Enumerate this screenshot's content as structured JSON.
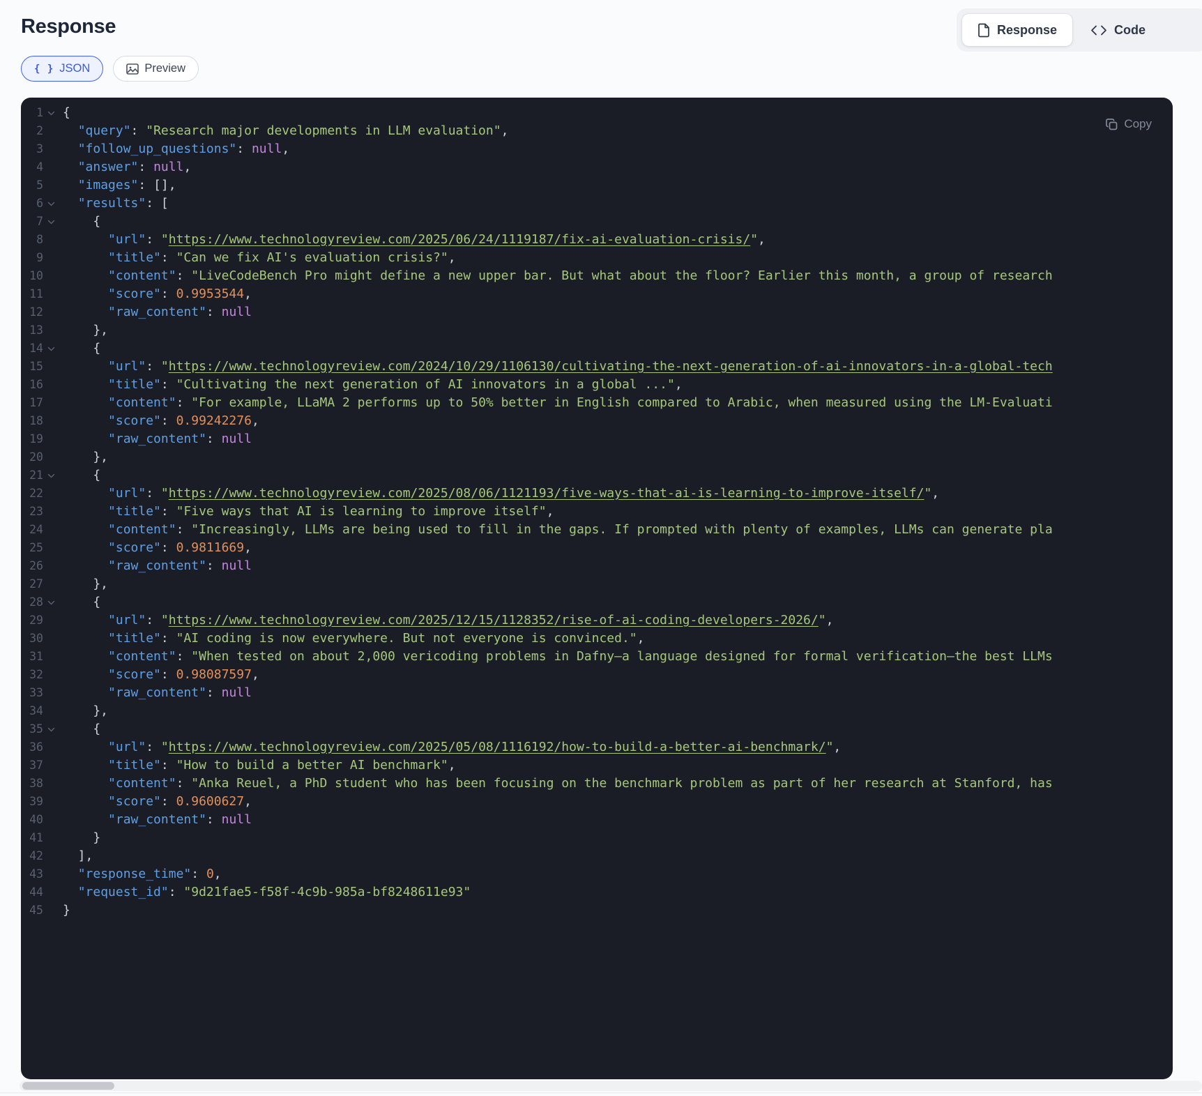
{
  "header": {
    "title": "Response",
    "modes": [
      {
        "label": "Response",
        "icon": "document-icon",
        "active": true
      },
      {
        "label": "Code",
        "icon": "code-icon",
        "active": false
      }
    ]
  },
  "tabs": [
    {
      "label": "JSON",
      "icon": "braces-icon",
      "active": true,
      "icon_glyph": "{ }"
    },
    {
      "label": "Preview",
      "icon": "image-icon",
      "active": false
    }
  ],
  "editor": {
    "copy_label": "Copy",
    "colors": {
      "background": "#1b1d26",
      "line_number": "#58606f",
      "key": "#5e9fe6",
      "string": "#a6c87c",
      "number": "#e2905c",
      "null": "#c287dd",
      "punctuation": "#ccd2dc",
      "accent_blue": "#4263eb"
    },
    "lines": [
      {
        "n": 1,
        "c": true,
        "s": [
          [
            "p",
            "{"
          ]
        ]
      },
      {
        "n": 2,
        "c": false,
        "s": [
          [
            "p",
            "  "
          ],
          [
            "k",
            "\"query\""
          ],
          [
            "p",
            ": "
          ],
          [
            "s",
            "\"Research major developments in LLM evaluation\""
          ],
          [
            "p",
            ","
          ]
        ]
      },
      {
        "n": 3,
        "c": false,
        "s": [
          [
            "p",
            "  "
          ],
          [
            "k",
            "\"follow_up_questions\""
          ],
          [
            "p",
            ": "
          ],
          [
            "x",
            "null"
          ],
          [
            "p",
            ","
          ]
        ]
      },
      {
        "n": 4,
        "c": false,
        "s": [
          [
            "p",
            "  "
          ],
          [
            "k",
            "\"answer\""
          ],
          [
            "p",
            ": "
          ],
          [
            "x",
            "null"
          ],
          [
            "p",
            ","
          ]
        ]
      },
      {
        "n": 5,
        "c": false,
        "s": [
          [
            "p",
            "  "
          ],
          [
            "k",
            "\"images\""
          ],
          [
            "p",
            ": [],"
          ]
        ]
      },
      {
        "n": 6,
        "c": true,
        "s": [
          [
            "p",
            "  "
          ],
          [
            "k",
            "\"results\""
          ],
          [
            "p",
            ": ["
          ]
        ]
      },
      {
        "n": 7,
        "c": true,
        "s": [
          [
            "p",
            "    {"
          ]
        ]
      },
      {
        "n": 8,
        "c": false,
        "s": [
          [
            "p",
            "      "
          ],
          [
            "k",
            "\"url\""
          ],
          [
            "p",
            ": "
          ],
          [
            "s",
            "\""
          ],
          [
            "u",
            "https://www.technologyreview.com/2025/06/24/1119187/fix-ai-evaluation-crisis/"
          ],
          [
            "s",
            "\""
          ],
          [
            "p",
            ","
          ]
        ]
      },
      {
        "n": 9,
        "c": false,
        "s": [
          [
            "p",
            "      "
          ],
          [
            "k",
            "\"title\""
          ],
          [
            "p",
            ": "
          ],
          [
            "s",
            "\"Can we fix AI's evaluation crisis?\""
          ],
          [
            "p",
            ","
          ]
        ]
      },
      {
        "n": 10,
        "c": false,
        "s": [
          [
            "p",
            "      "
          ],
          [
            "k",
            "\"content\""
          ],
          [
            "p",
            ": "
          ],
          [
            "s",
            "\"LiveCodeBench Pro might define a new upper bar. But what about the floor? Earlier this month, a group of research"
          ]
        ]
      },
      {
        "n": 11,
        "c": false,
        "s": [
          [
            "p",
            "      "
          ],
          [
            "k",
            "\"score\""
          ],
          [
            "p",
            ": "
          ],
          [
            "n",
            "0.9953544"
          ],
          [
            "p",
            ","
          ]
        ]
      },
      {
        "n": 12,
        "c": false,
        "s": [
          [
            "p",
            "      "
          ],
          [
            "k",
            "\"raw_content\""
          ],
          [
            "p",
            ": "
          ],
          [
            "x",
            "null"
          ]
        ]
      },
      {
        "n": 13,
        "c": false,
        "s": [
          [
            "p",
            "    },"
          ]
        ]
      },
      {
        "n": 14,
        "c": true,
        "s": [
          [
            "p",
            "    {"
          ]
        ]
      },
      {
        "n": 15,
        "c": false,
        "s": [
          [
            "p",
            "      "
          ],
          [
            "k",
            "\"url\""
          ],
          [
            "p",
            ": "
          ],
          [
            "s",
            "\""
          ],
          [
            "u",
            "https://www.technologyreview.com/2024/10/29/1106130/cultivating-the-next-generation-of-ai-innovators-in-a-global-tech"
          ]
        ]
      },
      {
        "n": 16,
        "c": false,
        "s": [
          [
            "p",
            "      "
          ],
          [
            "k",
            "\"title\""
          ],
          [
            "p",
            ": "
          ],
          [
            "s",
            "\"Cultivating the next generation of AI innovators in a global ...\""
          ],
          [
            "p",
            ","
          ]
        ]
      },
      {
        "n": 17,
        "c": false,
        "s": [
          [
            "p",
            "      "
          ],
          [
            "k",
            "\"content\""
          ],
          [
            "p",
            ": "
          ],
          [
            "s",
            "\"For example, LLaMA 2 performs up to 50% better in English compared to Arabic, when measured using the LM-Evaluati"
          ]
        ]
      },
      {
        "n": 18,
        "c": false,
        "s": [
          [
            "p",
            "      "
          ],
          [
            "k",
            "\"score\""
          ],
          [
            "p",
            ": "
          ],
          [
            "n",
            "0.99242276"
          ],
          [
            "p",
            ","
          ]
        ]
      },
      {
        "n": 19,
        "c": false,
        "s": [
          [
            "p",
            "      "
          ],
          [
            "k",
            "\"raw_content\""
          ],
          [
            "p",
            ": "
          ],
          [
            "x",
            "null"
          ]
        ]
      },
      {
        "n": 20,
        "c": false,
        "s": [
          [
            "p",
            "    },"
          ]
        ]
      },
      {
        "n": 21,
        "c": true,
        "s": [
          [
            "p",
            "    {"
          ]
        ]
      },
      {
        "n": 22,
        "c": false,
        "s": [
          [
            "p",
            "      "
          ],
          [
            "k",
            "\"url\""
          ],
          [
            "p",
            ": "
          ],
          [
            "s",
            "\""
          ],
          [
            "u",
            "https://www.technologyreview.com/2025/08/06/1121193/five-ways-that-ai-is-learning-to-improve-itself/"
          ],
          [
            "s",
            "\""
          ],
          [
            "p",
            ","
          ]
        ]
      },
      {
        "n": 23,
        "c": false,
        "s": [
          [
            "p",
            "      "
          ],
          [
            "k",
            "\"title\""
          ],
          [
            "p",
            ": "
          ],
          [
            "s",
            "\"Five ways that AI is learning to improve itself\""
          ],
          [
            "p",
            ","
          ]
        ]
      },
      {
        "n": 24,
        "c": false,
        "s": [
          [
            "p",
            "      "
          ],
          [
            "k",
            "\"content\""
          ],
          [
            "p",
            ": "
          ],
          [
            "s",
            "\"Increasingly, LLMs are being used to fill in the gaps. If prompted with plenty of examples, LLMs can generate pla"
          ]
        ]
      },
      {
        "n": 25,
        "c": false,
        "s": [
          [
            "p",
            "      "
          ],
          [
            "k",
            "\"score\""
          ],
          [
            "p",
            ": "
          ],
          [
            "n",
            "0.9811669"
          ],
          [
            "p",
            ","
          ]
        ]
      },
      {
        "n": 26,
        "c": false,
        "s": [
          [
            "p",
            "      "
          ],
          [
            "k",
            "\"raw_content\""
          ],
          [
            "p",
            ": "
          ],
          [
            "x",
            "null"
          ]
        ]
      },
      {
        "n": 27,
        "c": false,
        "s": [
          [
            "p",
            "    },"
          ]
        ]
      },
      {
        "n": 28,
        "c": true,
        "s": [
          [
            "p",
            "    {"
          ]
        ]
      },
      {
        "n": 29,
        "c": false,
        "s": [
          [
            "p",
            "      "
          ],
          [
            "k",
            "\"url\""
          ],
          [
            "p",
            ": "
          ],
          [
            "s",
            "\""
          ],
          [
            "u",
            "https://www.technologyreview.com/2025/12/15/1128352/rise-of-ai-coding-developers-2026/"
          ],
          [
            "s",
            "\""
          ],
          [
            "p",
            ","
          ]
        ]
      },
      {
        "n": 30,
        "c": false,
        "s": [
          [
            "p",
            "      "
          ],
          [
            "k",
            "\"title\""
          ],
          [
            "p",
            ": "
          ],
          [
            "s",
            "\"AI coding is now everywhere. But not everyone is convinced.\""
          ],
          [
            "p",
            ","
          ]
        ]
      },
      {
        "n": 31,
        "c": false,
        "s": [
          [
            "p",
            "      "
          ],
          [
            "k",
            "\"content\""
          ],
          [
            "p",
            ": "
          ],
          [
            "s",
            "\"When tested on about 2,000 vericoding problems in Dafny—a language designed for formal verification—the best LLMs"
          ]
        ]
      },
      {
        "n": 32,
        "c": false,
        "s": [
          [
            "p",
            "      "
          ],
          [
            "k",
            "\"score\""
          ],
          [
            "p",
            ": "
          ],
          [
            "n",
            "0.98087597"
          ],
          [
            "p",
            ","
          ]
        ]
      },
      {
        "n": 33,
        "c": false,
        "s": [
          [
            "p",
            "      "
          ],
          [
            "k",
            "\"raw_content\""
          ],
          [
            "p",
            ": "
          ],
          [
            "x",
            "null"
          ]
        ]
      },
      {
        "n": 34,
        "c": false,
        "s": [
          [
            "p",
            "    },"
          ]
        ]
      },
      {
        "n": 35,
        "c": true,
        "s": [
          [
            "p",
            "    {"
          ]
        ]
      },
      {
        "n": 36,
        "c": false,
        "s": [
          [
            "p",
            "      "
          ],
          [
            "k",
            "\"url\""
          ],
          [
            "p",
            ": "
          ],
          [
            "s",
            "\""
          ],
          [
            "u",
            "https://www.technologyreview.com/2025/05/08/1116192/how-to-build-a-better-ai-benchmark/"
          ],
          [
            "s",
            "\""
          ],
          [
            "p",
            ","
          ]
        ]
      },
      {
        "n": 37,
        "c": false,
        "s": [
          [
            "p",
            "      "
          ],
          [
            "k",
            "\"title\""
          ],
          [
            "p",
            ": "
          ],
          [
            "s",
            "\"How to build a better AI benchmark\""
          ],
          [
            "p",
            ","
          ]
        ]
      },
      {
        "n": 38,
        "c": false,
        "s": [
          [
            "p",
            "      "
          ],
          [
            "k",
            "\"content\""
          ],
          [
            "p",
            ": "
          ],
          [
            "s",
            "\"Anka Reuel, a PhD student who has been focusing on the benchmark problem as part of her research at Stanford, has"
          ]
        ]
      },
      {
        "n": 39,
        "c": false,
        "s": [
          [
            "p",
            "      "
          ],
          [
            "k",
            "\"score\""
          ],
          [
            "p",
            ": "
          ],
          [
            "n",
            "0.9600627"
          ],
          [
            "p",
            ","
          ]
        ]
      },
      {
        "n": 40,
        "c": false,
        "s": [
          [
            "p",
            "      "
          ],
          [
            "k",
            "\"raw_content\""
          ],
          [
            "p",
            ": "
          ],
          [
            "x",
            "null"
          ]
        ]
      },
      {
        "n": 41,
        "c": false,
        "s": [
          [
            "p",
            "    }"
          ]
        ]
      },
      {
        "n": 42,
        "c": false,
        "s": [
          [
            "p",
            "  ],"
          ]
        ]
      },
      {
        "n": 43,
        "c": false,
        "s": [
          [
            "p",
            "  "
          ],
          [
            "k",
            "\"response_time\""
          ],
          [
            "p",
            ": "
          ],
          [
            "n",
            "0"
          ],
          [
            "p",
            ","
          ]
        ]
      },
      {
        "n": 44,
        "c": false,
        "s": [
          [
            "p",
            "  "
          ],
          [
            "k",
            "\"request_id\""
          ],
          [
            "p",
            ": "
          ],
          [
            "s",
            "\"9d21fae5-f58f-4c9b-985a-bf8248611e93\""
          ]
        ]
      },
      {
        "n": 45,
        "c": false,
        "s": [
          [
            "p",
            "}"
          ]
        ]
      }
    ]
  }
}
